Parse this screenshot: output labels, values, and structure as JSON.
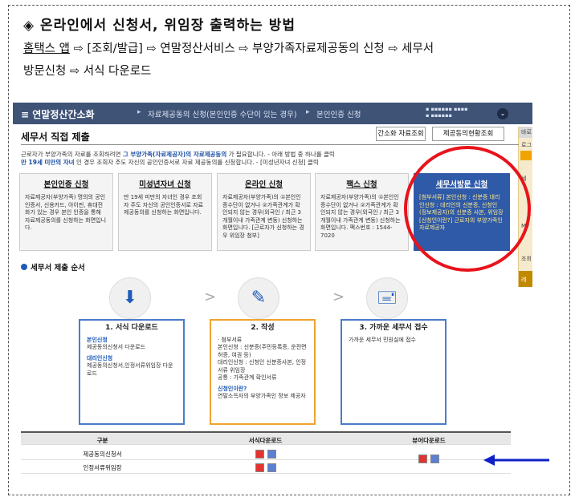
{
  "heading": {
    "bullet": "◈",
    "title": "온라인에서 신청서, 위임장 출력하는 방법"
  },
  "path": {
    "line1": [
      "홈택스 앱",
      "⇨",
      "[조회/발급]",
      "⇨",
      "연말정산서비스",
      "⇨",
      "부양가족자료제공동의 신청",
      "⇨",
      "세무서"
    ],
    "line2": [
      "방문신청",
      "⇨",
      "서식 다운로드"
    ]
  },
  "screenshot": {
    "topbar": {
      "menu_icon": "≡",
      "brand": "연말정산간소화",
      "crumb1": "자료제공동의 신청(본인인증 수단이 있는 경우)",
      "crumb2": "본인인증 신청",
      "circle": "⌄"
    },
    "page_title": "세무서 직접 제출",
    "buttons": {
      "btn1": "간소화 자료조회",
      "btn2": "제공동의현황조회"
    },
    "intro": {
      "line1_prefix": "근로자가 부양가족의 자료를 조회하려면",
      "line1_bold": "그 부양가족(자료제공자)의 자료제공동의",
      "line1_suffix": "가 필요합니다. - 아래 방법 중 하나를 클릭",
      "line2_bold": "만 19세 미만의 자녀",
      "line2_suffix": "인 경우 조회자 주도 자신의 공인인증서로 자료 제공동의를 신청합니다. - [미성년자녀 신청] 클릭"
    },
    "cards": [
      {
        "title": "본인인증 신청",
        "body": "자료제공자(부양가족) 명의의 공인인증서, 신용카드, 아이핀, 휴대전화가 있는 경우 본인 인증을 통해 자료제공동의를 신청하는 화면입니다."
      },
      {
        "title": "미성년자녀 신청",
        "body": "만 19세 미만의 자녀인 경우 조회자 주도 자신의 공인인증서로 자료 제공동의를 신청하는 화면입니다."
      },
      {
        "title": "온라인 신청",
        "body": "자료제공자(부양가족)의 ①본인인증수단이 없거나 ②가족관계가 확인되지 않는 경우(외국인 / 최근 3개월이내 가족관계 변동) 신청하는 화면입니다. [근로자가 신청하는 경우 위임장 첨부]"
      },
      {
        "title": "팩스 신청",
        "body": "자료제공자(부양가족)의 ①본인인증수단이 없거나 ②가족관계가 확인되지 않는 경우(외국인 / 최근 3개월이내 가족관계 변동) 신청하는 화면입니다. 팩스번호 : 1544-7020"
      },
      {
        "title": "세무서방문 신청",
        "body": "[첨부서류] 본인신청 : 신분증 대리인신청 : 대리인의 신분증, 신청인(정보제공자)의 신분증 사본, 위임장 [신청인이란?] 근로자의 부양가족인 자료제공자"
      }
    ],
    "section_title": "세무서 제출 순서",
    "steps": [
      {
        "icon": "⬇",
        "title": "1. 서식 다운로드",
        "lines": [
          "본인신청",
          "제공동의신청서 다운로드",
          "대리인신청",
          "제공동의신청서,인정서류위임장 다운로드"
        ]
      },
      {
        "icon": "✎",
        "title": "2. 작성",
        "lines": [
          "· 첨부서류",
          "본인신청 : 신분증(주민등록증, 운전면허증, 여권 등)",
          "대리인신청 : 신청인 신분증사본, 인정서류 위임장",
          "공통 : 가족관계 확인서류",
          "신청인이란?",
          "연말소득자의 부양가족인 정보 제공자"
        ]
      },
      {
        "icon": "🖃",
        "title": "3. 가까운 세무서 접수",
        "lines": [
          "가까운 세무서 민원실에 접수"
        ]
      }
    ],
    "chevron": ">",
    "table": {
      "headers": [
        "구분",
        "서식다운로드",
        "뷰어다운로드"
      ],
      "rows": [
        {
          "name": "제공동의신청서"
        },
        {
          "name": "인정서류위임장"
        }
      ]
    },
    "right_strip": {
      "labels": [
        "바로",
        "로그",
        "세",
        "My",
        "조회",
        "레"
      ]
    }
  },
  "colors": {
    "topbar": "#3f5377",
    "highlight_card": "#2f5aa8",
    "red_circle": "#e8131b",
    "blue_arrow": "#1020c8"
  }
}
